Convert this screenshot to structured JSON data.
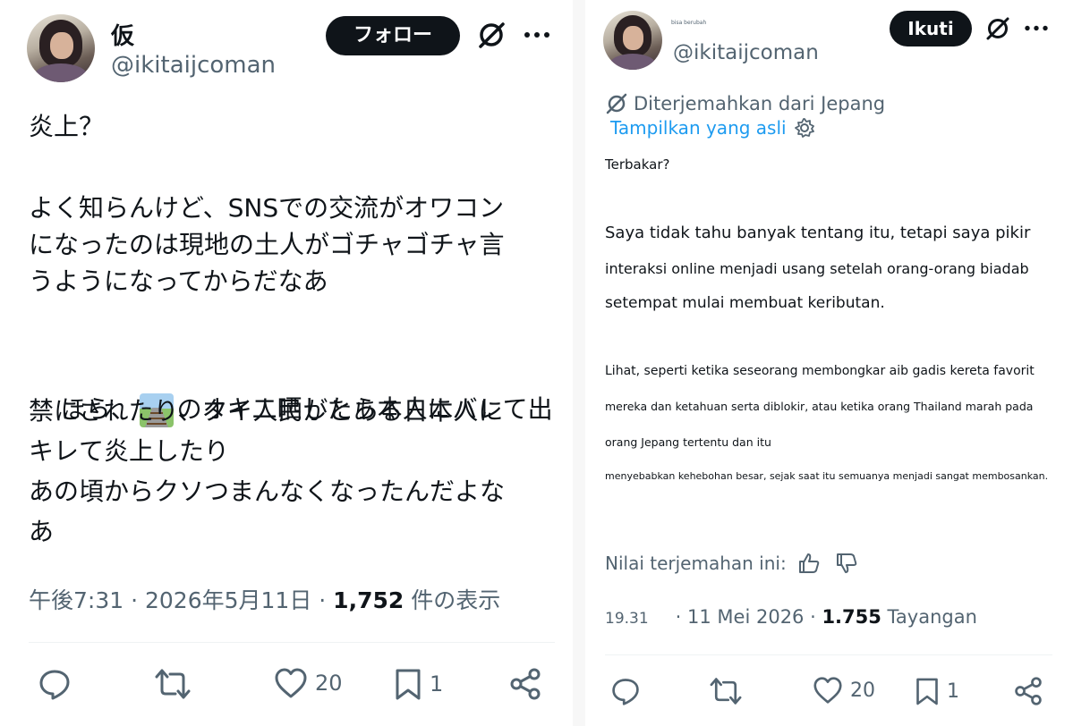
{
  "left": {
    "name": "仮",
    "handle": "@ikitaijcoman",
    "follow_label": "フォロー",
    "tweet_p1": "炎上？",
    "tweet_p2": "よく知らんけど、SNSでの交流がオワコン\nになったのは現地の土人がゴチャゴチャ言\nうようになってからだなあ",
    "tweet_p3a": "ほら、",
    "tweet_p3b": "のオキ二晒したら本人にバレて出",
    "tweet_p3c": "禁にされたり、タイ人民がとある日本人に\nキレて炎上したり\nあの頃からクソつまんなくなったんだよな\nあ",
    "time": "午後7:31 · 2026年5月11日 · ",
    "views_count": "1,752",
    "views_label": " 件の表示",
    "likes": "20",
    "bookmarks": "1",
    "emoji_icon": "railway-track-emoji"
  },
  "right": {
    "name": "bisa berubah",
    "handle": "@ikitaijcoman",
    "follow_label": "Ikuti",
    "translated_from": "Diterjemahkan dari Jepang",
    "show_original": "Tampilkan yang asli",
    "line1": "Terbakar?",
    "line2": "Saya tidak tahu banyak tentang itu, tetapi saya pikir",
    "line3": "interaksi online menjadi usang setelah orang-orang biadab",
    "line4": "setempat mulai membuat keributan.",
    "line5": "Lihat, seperti ketika seseorang membongkar aib gadis kereta favorit",
    "line6": "mereka dan ketahuan serta diblokir, atau ketika orang Thailand marah pada",
    "line7": "orang Jepang tertentu dan itu",
    "line8": "menyebabkan kehebohan besar, sejak saat itu semuanya menjadi sangat membosankan.",
    "rate_label": "Nilai terjemahan ini:",
    "time": "19.31",
    "date": "· 11 Mei 2026 · ",
    "views_count": "1.755",
    "views_label": " Tayangan",
    "likes": "20",
    "bookmarks": "1"
  },
  "colors": {
    "text": "#0f1419",
    "secondary": "#536471",
    "link": "#1d9bf0",
    "button": "#0f1419"
  }
}
